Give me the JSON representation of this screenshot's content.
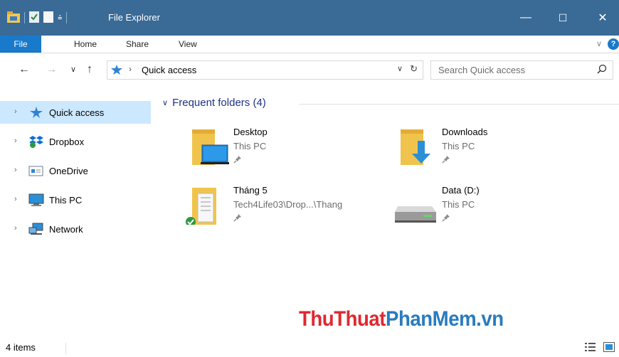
{
  "window": {
    "title": "File Explorer",
    "minimize": "—",
    "maximize": "☐",
    "close": "✕"
  },
  "ribbon": {
    "tabs": [
      "File",
      "Home",
      "Share",
      "View"
    ],
    "help": "?"
  },
  "address": {
    "location": "Quick access",
    "search_placeholder": "Search Quick access"
  },
  "nav": {
    "items": [
      {
        "label": "Quick access",
        "icon": "quick-access-pin-icon",
        "selected": true
      },
      {
        "label": "Dropbox",
        "icon": "dropbox-icon"
      },
      {
        "label": "OneDrive",
        "icon": "onedrive-icon"
      },
      {
        "label": "This PC",
        "icon": "this-pc-icon"
      },
      {
        "label": "Network",
        "icon": "network-icon"
      }
    ]
  },
  "content": {
    "group_title": "Frequent folders (4)",
    "folders": [
      {
        "name": "Desktop",
        "location": "This PC",
        "icon": "desktop-folder-icon"
      },
      {
        "name": "Downloads",
        "location": "This PC",
        "icon": "downloads-folder-icon"
      },
      {
        "name": "Tháng 5",
        "location": "Tech4Life03\\Drop...\\Thang",
        "icon": "synced-folder-icon"
      },
      {
        "name": "Data (D:)",
        "location": "This PC",
        "icon": "drive-icon"
      }
    ]
  },
  "watermark": {
    "part1": "ThuThuat",
    "part2": "PhanMem.vn"
  },
  "status": {
    "item_count": "4 items"
  },
  "colors": {
    "titlebar": "#3a6a96",
    "accent": "#1979ca",
    "selected": "#cce8ff",
    "group_header": "#1e3287"
  }
}
